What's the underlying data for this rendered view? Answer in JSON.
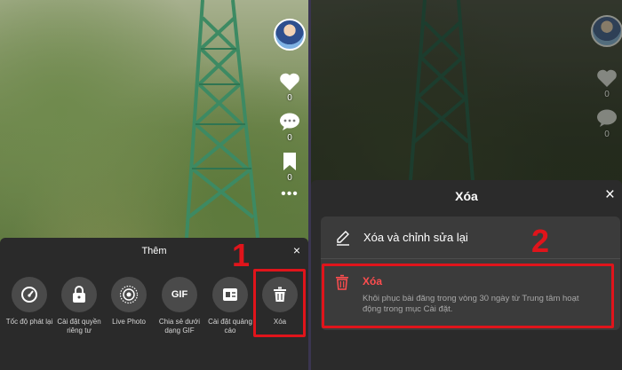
{
  "left": {
    "actions": {
      "like_count": "0",
      "comment_count": "0",
      "save_count": "0",
      "more": "•••"
    },
    "sheet": {
      "title": "Thêm",
      "close": "×",
      "options": [
        {
          "label": "Tốc độ phát lại",
          "icon": "speed-icon"
        },
        {
          "label": "Cài đặt quyền riêng tư",
          "icon": "lock-icon"
        },
        {
          "label": "Live Photo",
          "icon": "live-photo-icon"
        },
        {
          "label": "Chia sẻ dưới dạng GIF",
          "icon": "gif-icon",
          "icon_text": "GIF"
        },
        {
          "label": "Cài đặt quảng cáo",
          "icon": "ad-settings-icon"
        },
        {
          "label": "Xóa",
          "icon": "trash-icon"
        }
      ]
    },
    "step": "1"
  },
  "right": {
    "actions": {
      "like_count": "0",
      "comment_count": "0"
    },
    "sheet": {
      "title": "Xóa",
      "close": "×",
      "edit_option": "Xóa và chỉnh sửa lại",
      "delete_option": {
        "title": "Xóa",
        "description": "Khôi phục bài đăng trong vòng 30 ngày từ Trung tâm hoạt động trong mục Cài đặt."
      }
    },
    "step": "2"
  },
  "colors": {
    "highlight": "#e0141b",
    "delete_red": "#ff4d4f",
    "sheet_bg": "#2a2a2a"
  }
}
